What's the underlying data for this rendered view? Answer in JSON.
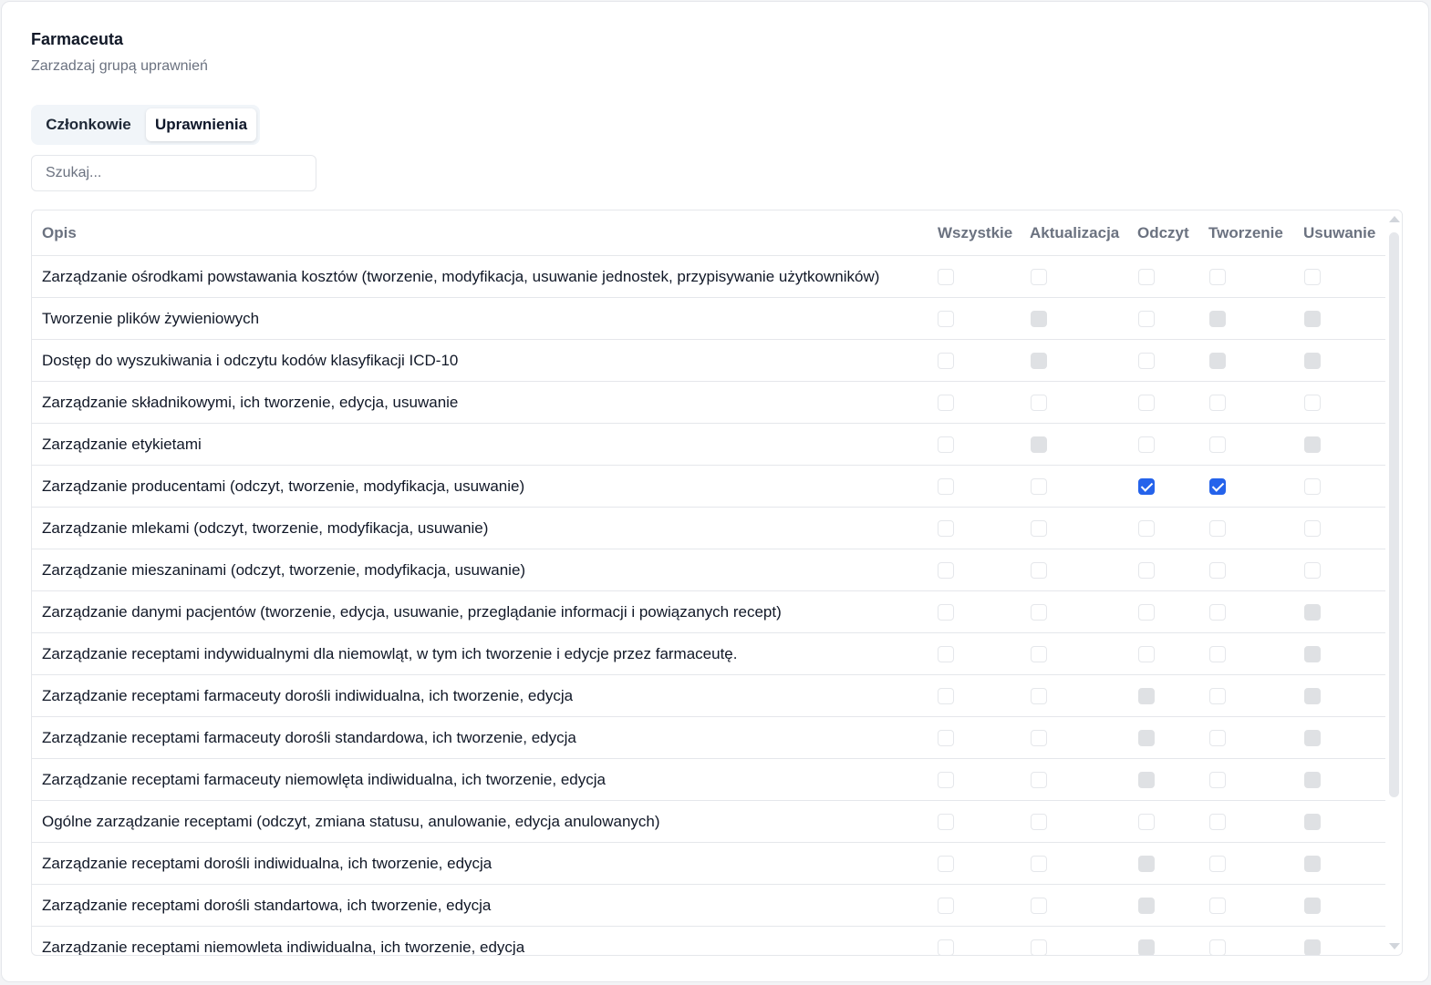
{
  "header": {
    "title": "Farmaceuta",
    "subtitle": "Zarzadzaj grupą uprawnień"
  },
  "tabs": [
    {
      "label": "Członkowie",
      "active": false
    },
    {
      "label": "Uprawnienia",
      "active": true
    }
  ],
  "search": {
    "placeholder": "Szukaj...",
    "value": ""
  },
  "table": {
    "columns": [
      "Opis",
      "Wszystkie",
      "Aktualizacja",
      "Odczyt",
      "Tworzenie",
      "Usuwanie"
    ],
    "rows": [
      {
        "opis": "Zarządzanie ośrodkami powstawania kosztów (tworzenie, modyfikacja, usuwanie jednostek, przypisywanie użytkowników)",
        "perms": [
          "unchecked",
          "unchecked",
          "unchecked",
          "unchecked",
          "unchecked"
        ]
      },
      {
        "opis": "Tworzenie plików żywieniowych",
        "perms": [
          "unchecked",
          "disabled",
          "unchecked",
          "disabled",
          "disabled"
        ]
      },
      {
        "opis": "Dostęp do wyszukiwania i odczytu kodów klasyfikacji ICD-10",
        "perms": [
          "unchecked",
          "disabled",
          "unchecked",
          "disabled",
          "disabled"
        ]
      },
      {
        "opis": "Zarządzanie składnikowymi, ich tworzenie, edycja, usuwanie",
        "perms": [
          "unchecked",
          "unchecked",
          "unchecked",
          "unchecked",
          "unchecked"
        ]
      },
      {
        "opis": "Zarządzanie etykietami",
        "perms": [
          "unchecked",
          "disabled",
          "unchecked",
          "unchecked",
          "disabled"
        ]
      },
      {
        "opis": "Zarządzanie producentami (odczyt, tworzenie, modyfikacja, usuwanie)",
        "perms": [
          "unchecked",
          "unchecked",
          "checked",
          "checked",
          "unchecked"
        ]
      },
      {
        "opis": "Zarządzanie mlekami (odczyt, tworzenie, modyfikacja, usuwanie)",
        "perms": [
          "unchecked",
          "unchecked",
          "unchecked",
          "unchecked",
          "unchecked"
        ]
      },
      {
        "opis": "Zarządzanie mieszaninami (odczyt, tworzenie, modyfikacja, usuwanie)",
        "perms": [
          "unchecked",
          "unchecked",
          "unchecked",
          "unchecked",
          "unchecked"
        ]
      },
      {
        "opis": "Zarządzanie danymi pacjentów (tworzenie, edycja, usuwanie, przeglądanie informacji i powiązanych recept)",
        "perms": [
          "unchecked",
          "unchecked",
          "unchecked",
          "unchecked",
          "disabled"
        ]
      },
      {
        "opis": "Zarządzanie receptami indywidualnymi dla niemowląt, w tym ich tworzenie i edycje przez farmaceutę.",
        "perms": [
          "unchecked",
          "unchecked",
          "unchecked",
          "unchecked",
          "disabled"
        ]
      },
      {
        "opis": "Zarządzanie receptami farmaceuty dorośli indiwidualna, ich tworzenie, edycja",
        "perms": [
          "unchecked",
          "unchecked",
          "disabled",
          "unchecked",
          "disabled"
        ]
      },
      {
        "opis": "Zarządzanie receptami farmaceuty dorośli standardowa, ich tworzenie, edycja",
        "perms": [
          "unchecked",
          "unchecked",
          "disabled",
          "unchecked",
          "disabled"
        ]
      },
      {
        "opis": "Zarządzanie receptami farmaceuty niemowlęta indiwidualna, ich tworzenie, edycja",
        "perms": [
          "unchecked",
          "unchecked",
          "disabled",
          "unchecked",
          "disabled"
        ]
      },
      {
        "opis": "Ogólne zarządzanie receptami (odczyt, zmiana statusu, anulowanie, edycja anulowanych)",
        "perms": [
          "unchecked",
          "unchecked",
          "unchecked",
          "unchecked",
          "disabled"
        ]
      },
      {
        "opis": "Zarządzanie receptami dorośli indiwidualna, ich tworzenie, edycja",
        "perms": [
          "unchecked",
          "unchecked",
          "disabled",
          "unchecked",
          "disabled"
        ]
      },
      {
        "opis": "Zarządzanie receptami dorośli standartowa, ich tworzenie, edycja",
        "perms": [
          "unchecked",
          "unchecked",
          "disabled",
          "unchecked",
          "disabled"
        ]
      },
      {
        "opis": "Zarządzanie receptami niemowleta indiwidualna, ich tworzenie, edycja",
        "perms": [
          "unchecked",
          "unchecked",
          "disabled",
          "unchecked",
          "disabled"
        ]
      }
    ]
  },
  "colors": {
    "checked": "#2563eb",
    "disabled": "#c6c9ce",
    "border": "#e5e7eb",
    "muted_text": "#6b7280"
  }
}
